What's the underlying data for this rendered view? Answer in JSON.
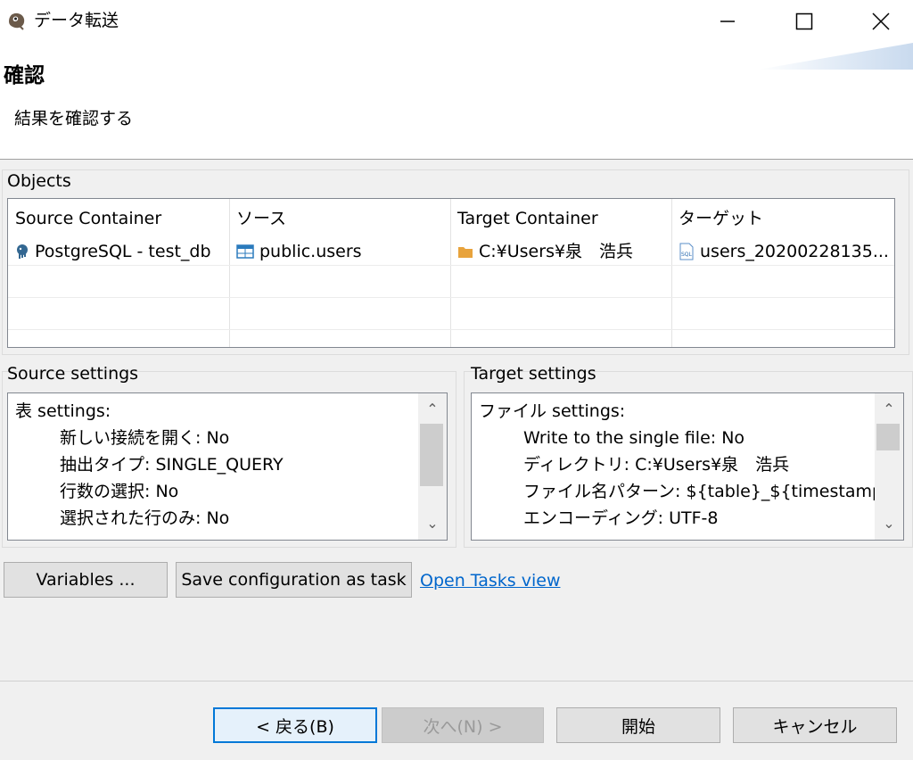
{
  "window": {
    "title": "データ転送"
  },
  "header": {
    "title": "確認",
    "subtitle": "結果を確認する"
  },
  "objects": {
    "label": "Objects",
    "columns": [
      "Source Container",
      "ソース",
      "Target Container",
      "ターゲット"
    ],
    "rows": [
      {
        "source_container": "PostgreSQL - test_db",
        "source": "public.users",
        "target_container": "C:¥Users¥泉　浩兵",
        "target": "users_20200228135..."
      }
    ]
  },
  "source_settings": {
    "label": "Source settings",
    "heading": "表 settings:",
    "lines": [
      "新しい接続を開く: No",
      "抽出タイプ: SINGLE_QUERY",
      "行数の選択: No",
      "選択された行のみ: No"
    ]
  },
  "target_settings": {
    "label": "Target settings",
    "heading": "ファイル settings:",
    "lines": [
      "Write to the single file: No",
      "ディレクトリ: C:¥Users¥泉　浩兵",
      "ファイル名パターン: ${table}_${timestamp}",
      "エンコーディング: UTF-8"
    ]
  },
  "actions": {
    "variables": "Variables ...",
    "save_task": "Save configuration as task",
    "open_tasks": "Open Tasks view"
  },
  "footer": {
    "back": "< 戻る(B)",
    "next": "次へ(N) >",
    "start": "開始",
    "cancel": "キャンセル"
  },
  "colors": {
    "link": "#0066cc",
    "focus_border": "#0078d7",
    "folder": "#e8a33c"
  }
}
